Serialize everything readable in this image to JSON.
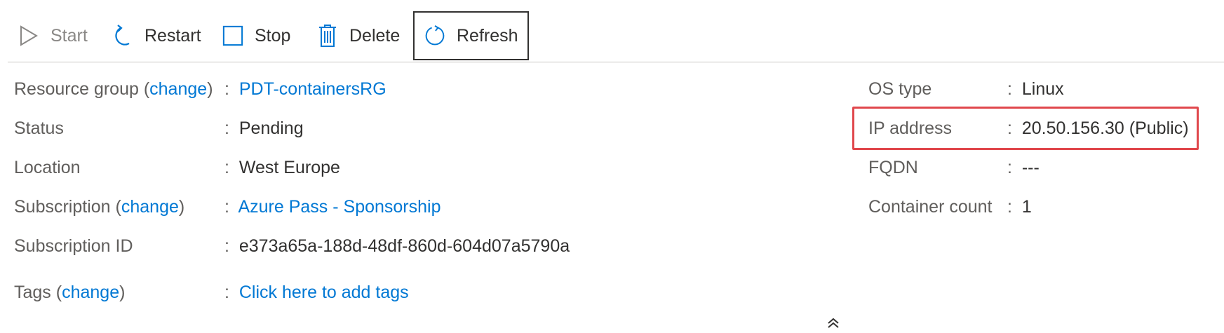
{
  "toolbar": {
    "start": {
      "label": "Start",
      "icon": "play-icon",
      "disabled": true
    },
    "restart": {
      "label": "Restart",
      "icon": "restart-icon"
    },
    "stop": {
      "label": "Stop",
      "icon": "stop-icon"
    },
    "delete": {
      "label": "Delete",
      "icon": "trash-icon"
    },
    "refresh": {
      "label": "Refresh",
      "icon": "refresh-icon"
    }
  },
  "essentials": {
    "left": {
      "resource_group": {
        "label_pre": "Resource group (",
        "change": "change",
        "label_post": ")",
        "value": "PDT-containersRG"
      },
      "status": {
        "label": "Status",
        "value": "Pending"
      },
      "location": {
        "label": "Location",
        "value": "West Europe"
      },
      "subscription": {
        "label_pre": "Subscription (",
        "change": "change",
        "label_post": ")",
        "value": "Azure Pass - Sponsorship"
      },
      "subscription_id": {
        "label": "Subscription ID",
        "value": "e373a65a-188d-48df-860d-604d07a5790a"
      },
      "tags": {
        "label_pre": "Tags (",
        "change": "change",
        "label_post": ")",
        "value": "Click here to add tags"
      }
    },
    "right": {
      "os_type": {
        "label": "OS type",
        "value": "Linux"
      },
      "ip_address": {
        "label": "IP address",
        "value": "20.50.156.30 (Public)"
      },
      "fqdn": {
        "label": "FQDN",
        "value": "---"
      },
      "container_count": {
        "label": "Container count",
        "value": "1"
      }
    },
    "colon": ":"
  },
  "colors": {
    "link": "#0078d4",
    "highlight": "#e0474c",
    "text": "#323130",
    "label": "#605e5c"
  }
}
